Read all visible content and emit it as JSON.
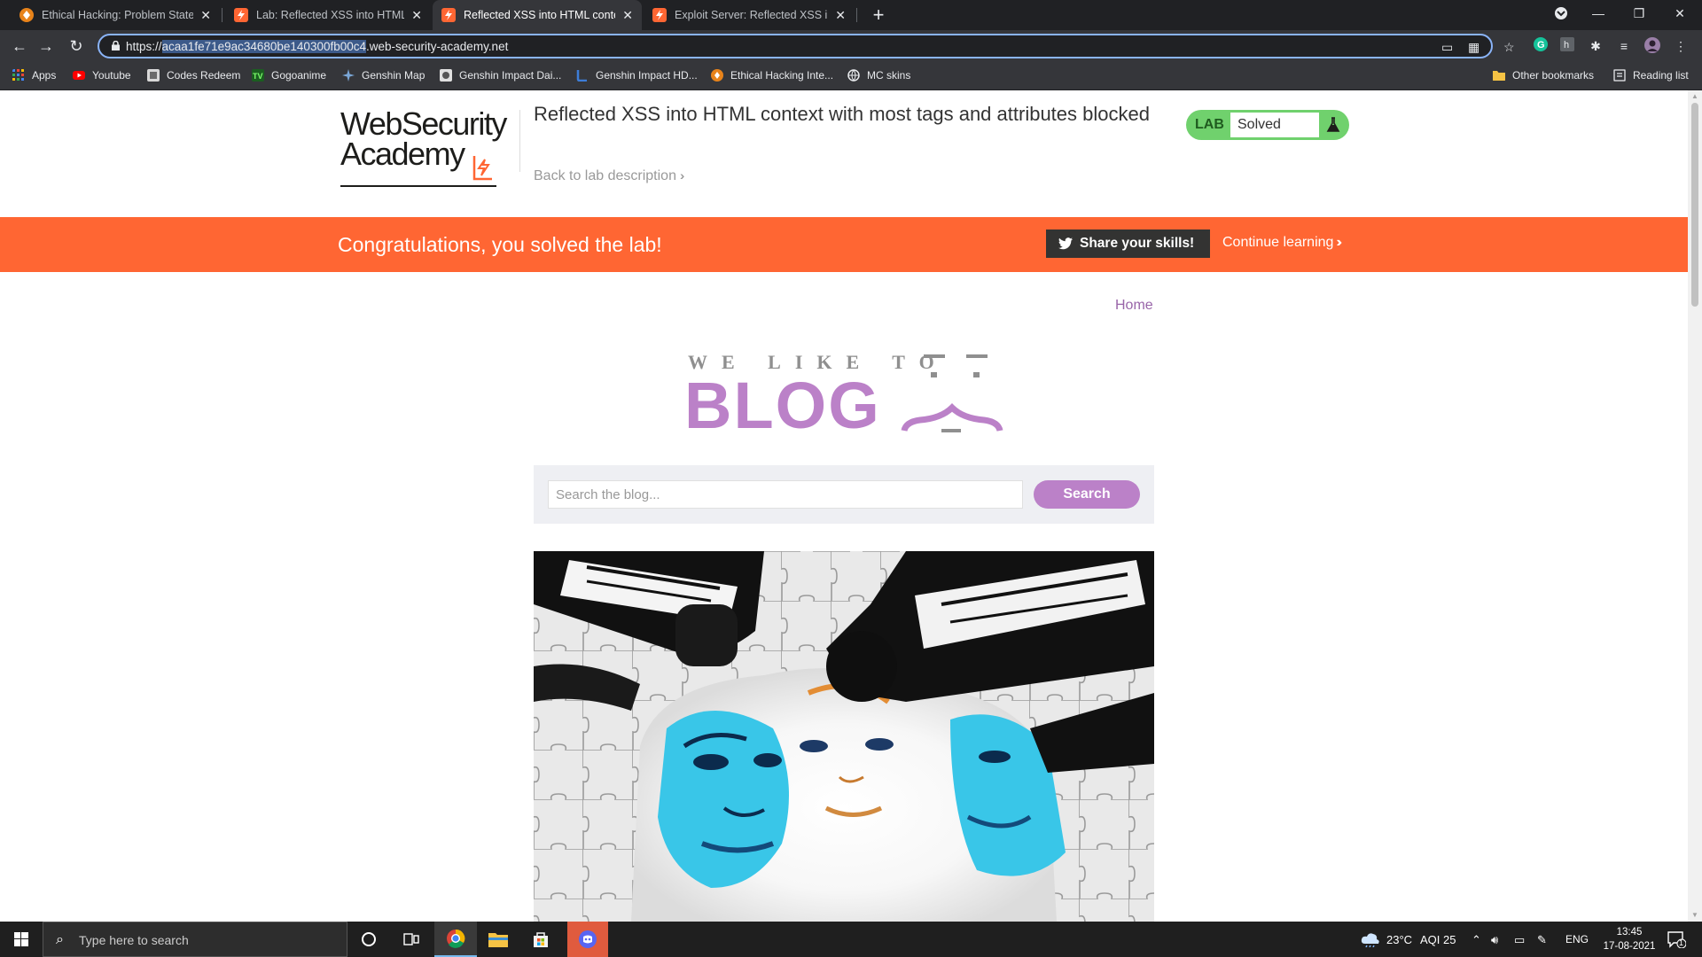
{
  "browser": {
    "tabs": [
      {
        "title": "Ethical Hacking: Problem Statem",
        "favicon_color": "#e8831a",
        "active": false
      },
      {
        "title": "Lab: Reflected XSS into HTML co",
        "favicon_color": "#ff6633",
        "active": false
      },
      {
        "title": "Reflected XSS into HTML context",
        "favicon_color": "#ff6633",
        "active": true
      },
      {
        "title": "Exploit Server: Reflected XSS into",
        "favicon_color": "#ff6633",
        "active": false
      }
    ],
    "url": {
      "prefix": "https://",
      "selected": "acaa1fe71e9ac34680be140300fb00c4",
      "suffix": ".web-security-academy.net"
    },
    "bookmarks": [
      {
        "label": "Apps",
        "icon": "apps-grid-icon",
        "color": "#4285f4"
      },
      {
        "label": "Youtube",
        "icon": "youtube-icon",
        "color": "#ff0000"
      },
      {
        "label": "Codes Redeem",
        "icon": "codes-icon",
        "color": "#9e9e9e"
      },
      {
        "label": "Gogoanime",
        "icon": "gogoanime-icon",
        "color": "#2e7d32"
      },
      {
        "label": "Genshin Map",
        "icon": "map-icon",
        "color": "#7aa6d6"
      },
      {
        "label": "Genshin Impact Dai...",
        "icon": "genshin-icon",
        "color": "#cfcfcf"
      },
      {
        "label": "Genshin Impact HD...",
        "icon": "genshin-hd-icon",
        "color": "#3d7dd8"
      },
      {
        "label": "Ethical Hacking Inte...",
        "icon": "ethical-icon",
        "color": "#e8831a"
      },
      {
        "label": "MC skins",
        "icon": "globe-icon",
        "color": "#bdbdbd"
      }
    ],
    "other_bookmarks": "Other bookmarks",
    "reading_list": "Reading list"
  },
  "header": {
    "logo_line1": "WebSecurity",
    "logo_line2": "Academy",
    "lab_title": "Reflected XSS into HTML context with most tags and attributes blocked",
    "back_link": "Back to lab description",
    "lab_label": "LAB",
    "lab_status": "Solved"
  },
  "banner": {
    "message": "Congratulations, you solved the lab!",
    "share_label": "Share your skills!",
    "continue_label": "Continue learning"
  },
  "blog": {
    "home_link": "Home",
    "tagline": "WE LIKE TO",
    "brand": "BLOG",
    "search_placeholder": "Search the blog...",
    "search_button": "Search"
  },
  "taskbar": {
    "search_placeholder": "Type here to search",
    "weather": "23°C",
    "aqi": "AQI 25",
    "language": "ENG",
    "time": "13:45",
    "date": "17-08-2021",
    "notifications": "1"
  },
  "colors": {
    "accent_orange": "#ff6633",
    "blog_purple": "#bb81c8",
    "lab_green": "#70d16d"
  }
}
